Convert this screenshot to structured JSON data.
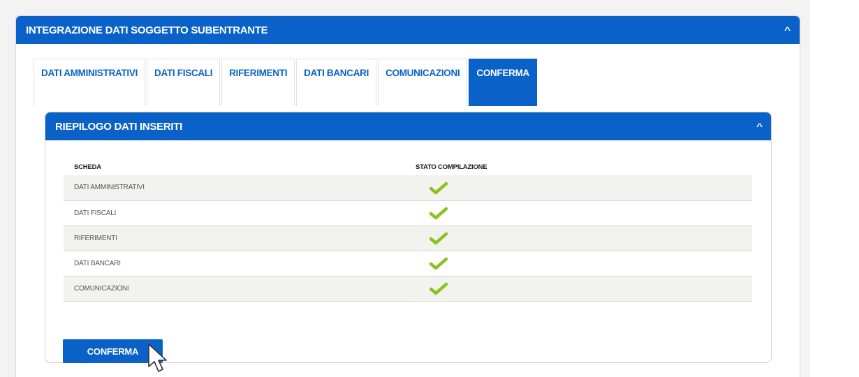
{
  "outer_panel": {
    "title": "INTEGRAZIONE DATI SOGGETTO SUBENTRANTE",
    "collapse_icon": "chevron-up-icon"
  },
  "tabs": [
    {
      "label": "DATI AMMINISTRATIVI",
      "active": false
    },
    {
      "label": "DATI FISCALI",
      "active": false
    },
    {
      "label": "RIFERIMENTI",
      "active": false
    },
    {
      "label": "DATI BANCARI",
      "active": false
    },
    {
      "label": "COMUNICAZIONI",
      "active": false
    },
    {
      "label": "CONFERMA",
      "active": true
    }
  ],
  "summary_panel": {
    "title": "RIEPILOGO DATI INSERITI",
    "collapse_icon": "chevron-up-icon",
    "columns": [
      "SCHEDA",
      "STATO COMPILAZIONE"
    ],
    "rows": [
      {
        "scheda": "DATI AMMINISTRATIVI",
        "status_icon": "check-icon"
      },
      {
        "scheda": "DATI FISCALI",
        "status_icon": "check-icon"
      },
      {
        "scheda": "RIFERIMENTI",
        "status_icon": "check-icon"
      },
      {
        "scheda": "DATI BANCARI",
        "status_icon": "check-icon"
      },
      {
        "scheda": "COMUNICAZIONI",
        "status_icon": "check-icon"
      }
    ],
    "confirm_button": "CONFERMA"
  },
  "colors": {
    "primary": "#0a62c9",
    "check": "#8cc21f",
    "row_stripe": "#f2f2ee"
  }
}
